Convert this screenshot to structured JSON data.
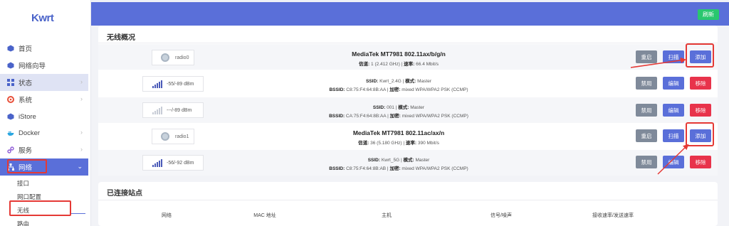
{
  "app": {
    "logo": "Kwrt"
  },
  "sidebar": {
    "items": [
      {
        "label": "首页",
        "chevron": false
      },
      {
        "label": "网络向导",
        "chevron": false
      },
      {
        "label": "状态",
        "chevron": true
      },
      {
        "label": "系统",
        "chevron": true
      },
      {
        "label": "iStore",
        "chevron": false
      },
      {
        "label": "Docker",
        "chevron": true
      },
      {
        "label": "服务",
        "chevron": true
      },
      {
        "label": "网络",
        "chevron": true
      }
    ],
    "network_sub": [
      "接口",
      "网口配置",
      "无线",
      "路由"
    ]
  },
  "toolbar": {
    "refresh_label": "刷新"
  },
  "wireless": {
    "title": "无线概况",
    "radios": [
      {
        "radio": "radio0",
        "device": "MediaTek MT7981 802.11ax/b/g/n",
        "channel_label": "信道:",
        "channel": "1 (2.412 GHz)",
        "rate_label": "速率:",
        "rate": "66.4 Mbit/s",
        "buttons": {
          "restart": "重启",
          "scan": "扫描",
          "add": "添加"
        },
        "networks": [
          {
            "signal": "-55/-89 dBm",
            "ssid_label": "SSID:",
            "ssid": "Kwrt_2.4G",
            "mode_label": "模式:",
            "mode": "Master",
            "bssid_label": "BSSID:",
            "bssid": "C8:75:F4:64:8B:AA",
            "enc_label": "加密:",
            "enc": "mixed WPA/WPA2 PSK (CCMP)",
            "buttons": {
              "disable": "禁用",
              "edit": "编辑",
              "remove": "移除"
            }
          },
          {
            "signal": "---/-89 dBm",
            "ssid_label": "SSID:",
            "ssid": "001",
            "mode_label": "模式:",
            "mode": "Master",
            "bssid_label": "BSSID:",
            "bssid": "CA:75:F4:64:8B:AA",
            "enc_label": "加密:",
            "enc": "mixed WPA/WPA2 PSK (CCMP)",
            "buttons": {
              "disable": "禁用",
              "edit": "编辑",
              "remove": "移除"
            }
          }
        ]
      },
      {
        "radio": "radio1",
        "device": "MediaTek MT7981 802.11ac/ax/n",
        "channel_label": "信道:",
        "channel": "36 (5.180 GHz)",
        "rate_label": "速率:",
        "rate": "390 Mbit/s",
        "buttons": {
          "restart": "重启",
          "scan": "扫描",
          "add": "添加"
        },
        "networks": [
          {
            "signal": "-56/-92 dBm",
            "ssid_label": "SSID:",
            "ssid": "Kwrt_5G",
            "mode_label": "模式:",
            "mode": "Master",
            "bssid_label": "BSSID:",
            "bssid": "C8:75:F4:64:8B:AB",
            "enc_label": "加密:",
            "enc": "mixed WPA/WPA2 PSK (CCMP)",
            "buttons": {
              "disable": "禁用",
              "edit": "编辑",
              "remove": "移除"
            }
          }
        ]
      }
    ]
  },
  "stations": {
    "title": "已连接站点",
    "columns": [
      "网络",
      "MAC 地址",
      "主机",
      "信号/噪声",
      "接收速率/发送速率"
    ]
  },
  "colors": {
    "accent": "#5a6fd9",
    "refresh": "#29c76f",
    "danger": "#e8334b",
    "neutral_button": "#7f8a9a",
    "annotation": "#e53935"
  }
}
